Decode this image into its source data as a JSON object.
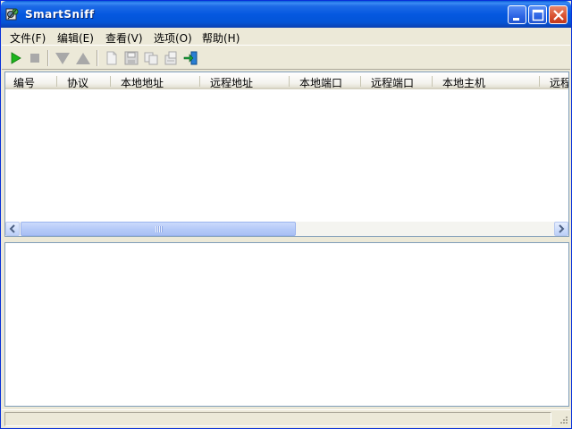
{
  "window": {
    "title": "SmartSniff"
  },
  "title_buttons": {
    "minimize": "minimize-icon",
    "maximize": "maximize-icon",
    "close": "close-icon"
  },
  "menu": [
    {
      "label": "文件(F)"
    },
    {
      "label": "编辑(E)"
    },
    {
      "label": "查看(V)"
    },
    {
      "label": "选项(O)"
    },
    {
      "label": "帮助(H)"
    }
  ],
  "toolbar": {
    "icons": [
      "play-icon",
      "stop-icon",
      "arrow-down-icon",
      "arrow-up-icon",
      "new-document-icon",
      "save-icon",
      "copy-icon",
      "properties-icon",
      "exit-icon"
    ]
  },
  "columns": [
    "编号",
    "协议",
    "本地地址",
    "远程地址",
    "本地端口",
    "远程端口",
    "本地主机",
    "远程"
  ],
  "rows": [],
  "status_bar": {
    "text": ""
  },
  "colors": {
    "titlebar": "#0558e0",
    "window_bg": "#ece9d8",
    "play": "#1cb51c"
  }
}
